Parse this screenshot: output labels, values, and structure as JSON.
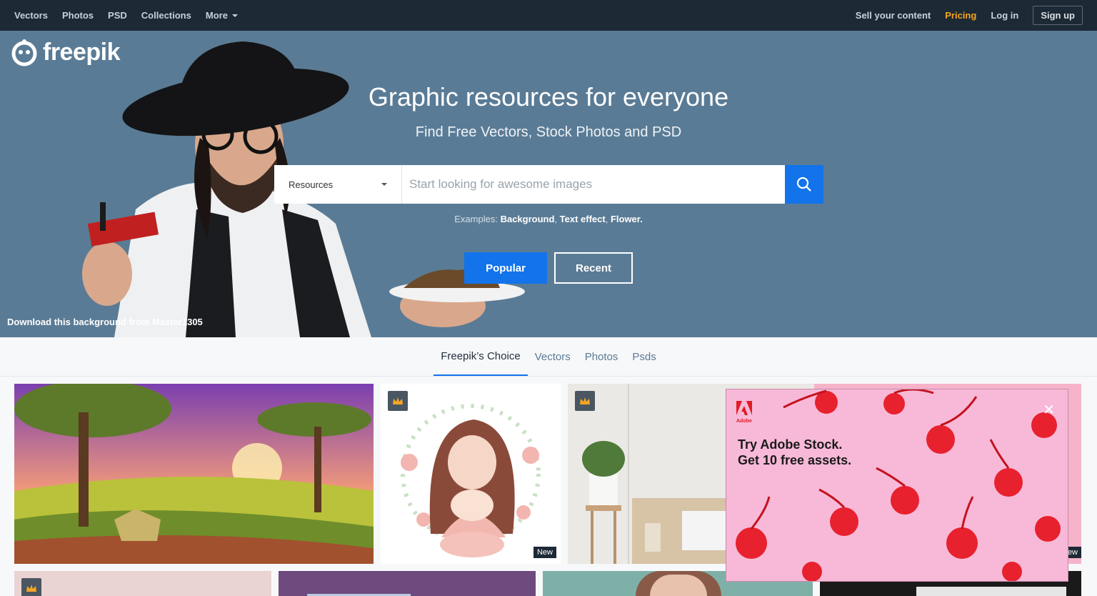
{
  "nav": {
    "links": [
      "Vectors",
      "Photos",
      "PSD",
      "Collections"
    ],
    "more": "More",
    "sell": "Sell your content",
    "pricing": "Pricing",
    "login": "Log in",
    "signup": "Sign up"
  },
  "hero": {
    "logo": "freepik",
    "title": "Graphic resources for everyone",
    "subtitle": "Find Free Vectors, Stock Photos and PSD",
    "search": {
      "resource_label": "Resources",
      "placeholder": "Start looking for awesome images"
    },
    "examples_label": "Examples:",
    "examples": [
      "Background",
      "Text effect",
      "Flower."
    ],
    "popular": "Popular",
    "recent": "Recent",
    "credit": "Download this background from Master1305"
  },
  "tabs": [
    "Freepik’s Choice",
    "Vectors",
    "Photos",
    "Psds"
  ],
  "gallery": {
    "new_label": "New",
    "new_label_partial": "ew"
  },
  "ad": {
    "brand": "Adobe",
    "line1": "Try Adobe Stock.",
    "line2": "Get 10 free assets.",
    "close": "✕"
  },
  "colors": {
    "nav_bg": "#1d2935",
    "accent_blue": "#1273eb",
    "pricing": "#f5a623",
    "hero_bg": "#5a7b95"
  }
}
